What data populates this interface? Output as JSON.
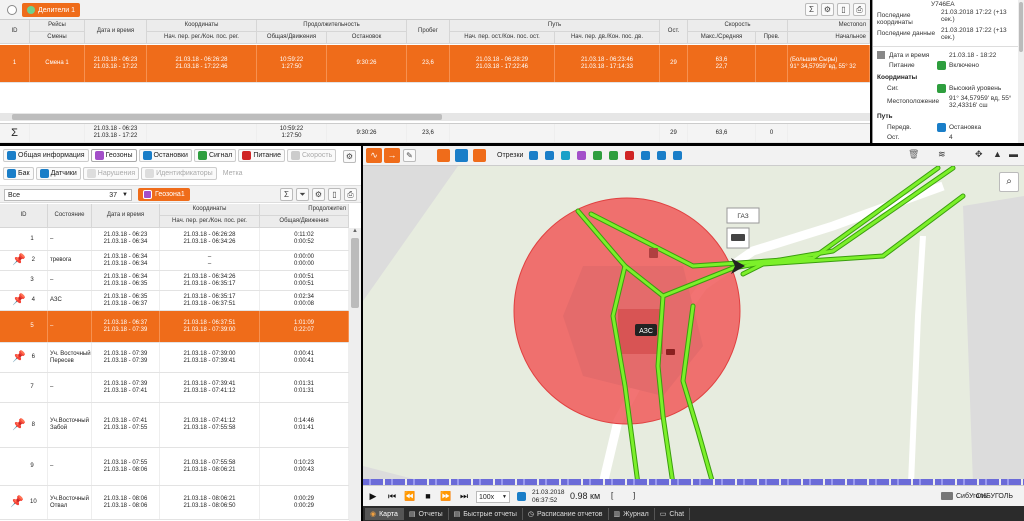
{
  "top_panel": {
    "tab_label": "Делители 1",
    "headers": {
      "id": "ID",
      "trips": "Рейсы",
      "shifts": "Смены",
      "datetime": "Дата и время",
      "coords": "Координаты",
      "coords_sub": "Нач. пер. рег./Кон. пос. рег.",
      "duration": "Продолжительность",
      "duration_total": "Общая/Движения",
      "stops": "Остановок",
      "mileage": "Пробег",
      "path": "Путь",
      "path_stop": "Нач. пер. ост./Кон. пос. ост.",
      "path_move": "Нач. пер. дв./Кон. пос. дв.",
      "ost": "Ост.",
      "speed": "Скорость",
      "speed_sub": "Макс./Средняя",
      "prev": "Прев.",
      "location": "Местопол",
      "location_sub": "Начальное"
    },
    "row": {
      "id": "1",
      "shift": "Смена 1",
      "dt1": "21.03.18 - 06:23",
      "dt2": "21.03.18 - 17:22",
      "c1": "21.03.18 - 06:26:28",
      "c2": "21.03.18 - 17:22:46",
      "dur1": "10:59:22",
      "dur2": "1:27:50",
      "stops": "9:30:26",
      "mileage": "23,6",
      "ps1": "21.03.18 - 06:28:29",
      "ps2": "21.03.18 - 17:22:46",
      "pm1": "21.03.18 - 06:23:46",
      "pm2": "21.03.18 - 17:14:33",
      "ost": "29",
      "sp1": "63,6",
      "sp2": "22,7",
      "loc1": "(Большие Сыры)",
      "loc2": "91° 34,57959' вд, 55° 32"
    },
    "totals": {
      "sigma": "Σ",
      "dt1": "21.03.18 - 06:23",
      "dt2": "21.03.18 - 17:22",
      "dur1": "10:59:22",
      "dur2": "1:27:50",
      "stops": "9:30:26",
      "mileage": "23,6",
      "ost": "29",
      "speed": "63,6",
      "prev": "0"
    }
  },
  "right_info": {
    "plate": "У746ЕА",
    "last_coords_label": "Последние координаты",
    "last_coords_value": "21.03.2018 17:22 (+13 сек.)",
    "last_data_label": "Последние данные",
    "last_data_value": "21.03.2018 17:22 (+13 сек.)",
    "dt_label": "Дата и время",
    "dt_value": "21.03.18 - 18:22",
    "power_label": "Питание",
    "power_value": "Включено",
    "coords_section": "Координаты",
    "sig_label": "Сиг.",
    "sig_value": "Высокий уровень",
    "loc_label": "Местоположение",
    "loc_value": "91° 34,57959' вд, 55° 32,43316' сш",
    "path_section": "Путь",
    "trans_label": "Передв.",
    "trans_value": "Остановка",
    "ost_label": "Ост.",
    "ost_value": "4"
  },
  "left_panel": {
    "tabs": [
      {
        "label": "Общая информация",
        "color": "#1a7ec8"
      },
      {
        "label": "Геозоны",
        "color": "#a34fc9"
      },
      {
        "label": "Остановки",
        "color": "#1a7ec8"
      },
      {
        "label": "Сигнал",
        "color": "#2e9e3e"
      },
      {
        "label": "Питание",
        "color": "#d02525"
      },
      {
        "label": "Скорость",
        "color": "#bbbbbb"
      }
    ],
    "tabs2": [
      {
        "label": "Бак",
        "color": "#1a7ec8"
      },
      {
        "label": "Датчики",
        "color": "#1a7ec8"
      },
      {
        "label": "Нарушения",
        "color": "#dddddd"
      },
      {
        "label": "Идентификаторы",
        "color": "#dddddd"
      },
      {
        "label": "Метка",
        "color": "#ffffff"
      }
    ],
    "filter_value": "Все",
    "filter_count": "37",
    "geozone_tab": "Геозона1",
    "headers": {
      "id": "ID",
      "state": "Состояние",
      "datetime": "Дата и время",
      "coords": "Координаты",
      "coords_sub": "Нач. пер. рег./Кон. пос. рег.",
      "duration": "Продолжител",
      "duration_sub": "Общая/Движения"
    },
    "rows": [
      {
        "id": "1",
        "state": "–",
        "dt1": "21.03.18 - 06:23",
        "dt2": "21.03.18 - 06:34",
        "c1": "21.03.18 - 06:26:28",
        "c2": "21.03.18 - 06:34:26",
        "d1": "0:11:02",
        "d2": "0:00:52",
        "pin": false
      },
      {
        "id": "2",
        "state": "тревога",
        "dt1": "21.03.18 - 06:34",
        "dt2": "21.03.18 - 06:34",
        "c1": "–",
        "c2": "–",
        "d1": "0:00:00",
        "d2": "0:00:00",
        "pin": true
      },
      {
        "id": "3",
        "state": "–",
        "dt1": "21.03.18 - 06:34",
        "dt2": "21.03.18 - 06:35",
        "c1": "21.03.18 - 06:34:26",
        "c2": "21.03.18 - 06:35:17",
        "d1": "0:00:51",
        "d2": "0:00:51",
        "pin": false
      },
      {
        "id": "4",
        "state": "АЗС",
        "dt1": "21.03.18 - 06:35",
        "dt2": "21.03.18 - 06:37",
        "c1": "21.03.18 - 06:35:17",
        "c2": "21.03.18 - 06:37:51",
        "d1": "0:02:34",
        "d2": "0:00:08",
        "pin": true
      },
      {
        "id": "5",
        "state": "–",
        "dt1": "21.03.18 - 06:37",
        "dt2": "21.03.18 - 07:39",
        "c1": "21.03.18 - 06:37:51",
        "c2": "21.03.18 - 07:39:00",
        "d1": "1:01:09",
        "d2": "0:22:07",
        "pin": false
      },
      {
        "id": "6",
        "state": "Уч. Восточный Пересев",
        "dt1": "21.03.18 - 07:39",
        "dt2": "21.03.18 - 07:39",
        "c1": "21.03.18 - 07:39:00",
        "c2": "21.03.18 - 07:39:41",
        "d1": "0:00:41",
        "d2": "0:00:41",
        "pin": true
      },
      {
        "id": "7",
        "state": "–",
        "dt1": "21.03.18 - 07:39",
        "dt2": "21.03.18 - 07:41",
        "c1": "21.03.18 - 07:39:41",
        "c2": "21.03.18 - 07:41:12",
        "d1": "0:01:31",
        "d2": "0:01:31",
        "pin": false
      },
      {
        "id": "8",
        "state": "Уч.Восточный Забой",
        "dt1": "21.03.18 - 07:41",
        "dt2": "21.03.18 - 07:55",
        "c1": "21.03.18 - 07:41:12",
        "c2": "21.03.18 - 07:55:58",
        "d1": "0:14:46",
        "d2": "0:01:41",
        "pin": true
      },
      {
        "id": "9",
        "state": "–",
        "dt1": "21.03.18 - 07:55",
        "dt2": "21.03.18 - 08:06",
        "c1": "21.03.18 - 07:55:58",
        "c2": "21.03.18 - 08:06:21",
        "d1": "0:10:23",
        "d2": "0:00:43",
        "pin": false
      },
      {
        "id": "10",
        "state": "Уч.Восточный Отвал",
        "dt1": "21.03.18 - 08:06",
        "dt2": "21.03.18 - 08:06",
        "c1": "21.03.18 - 08:06:21",
        "c2": "21.03.18 - 08:06:50",
        "d1": "0:00:29",
        "d2": "0:00:29",
        "pin": true
      }
    ]
  },
  "map": {
    "toolbar_label": "Отрезки",
    "vehicle_label": "ГАЗ",
    "zone_label": "АЗС",
    "search_icon": "search-icon",
    "playback": {
      "speed": "100x",
      "date": "21.03.2018",
      "time": "06:37:52",
      "distance": "0.98 км"
    },
    "folder_label": "СибУголь",
    "org_label": "СИБУГОЛЬ"
  },
  "bottom_tabs": [
    {
      "label": "Карта",
      "active": true
    },
    {
      "label": "Отчеты",
      "active": false
    },
    {
      "label": "Быстрые отчеты",
      "active": false
    },
    {
      "label": "Расписание отчетов",
      "active": false
    },
    {
      "label": "Журнал",
      "active": false
    },
    {
      "label": "Chat",
      "active": false
    }
  ],
  "colors": {
    "accent": "#ef6c1a",
    "track": "#6ee01a",
    "geofence": "#f05a5a",
    "map_bg": "#e7ecdf"
  }
}
